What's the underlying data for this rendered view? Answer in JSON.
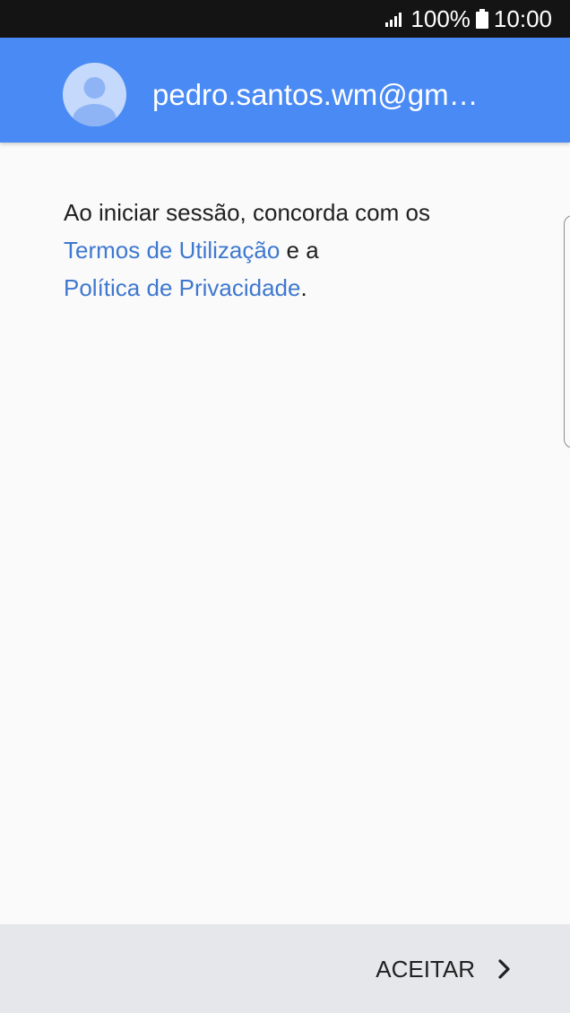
{
  "status_bar": {
    "battery_percent": "100%",
    "time": "10:00",
    "signal_icon": "signal-bars-icon",
    "battery_icon": "battery-full-icon"
  },
  "header": {
    "account_email": "pedro.santos.wm@gm…",
    "avatar_icon": "person-avatar-icon",
    "background_color": "#4a8af4"
  },
  "body": {
    "text_before": "Ao iniciar sessão, concorda com os",
    "terms_link": "Termos de Utilização",
    "text_between": " e a",
    "privacy_link": "Política de Privacidade",
    "text_after": ".",
    "link_color": "#3f78cf"
  },
  "footer": {
    "accept_label": "ACEITAR",
    "accept_icon": "chevron-right-icon"
  }
}
